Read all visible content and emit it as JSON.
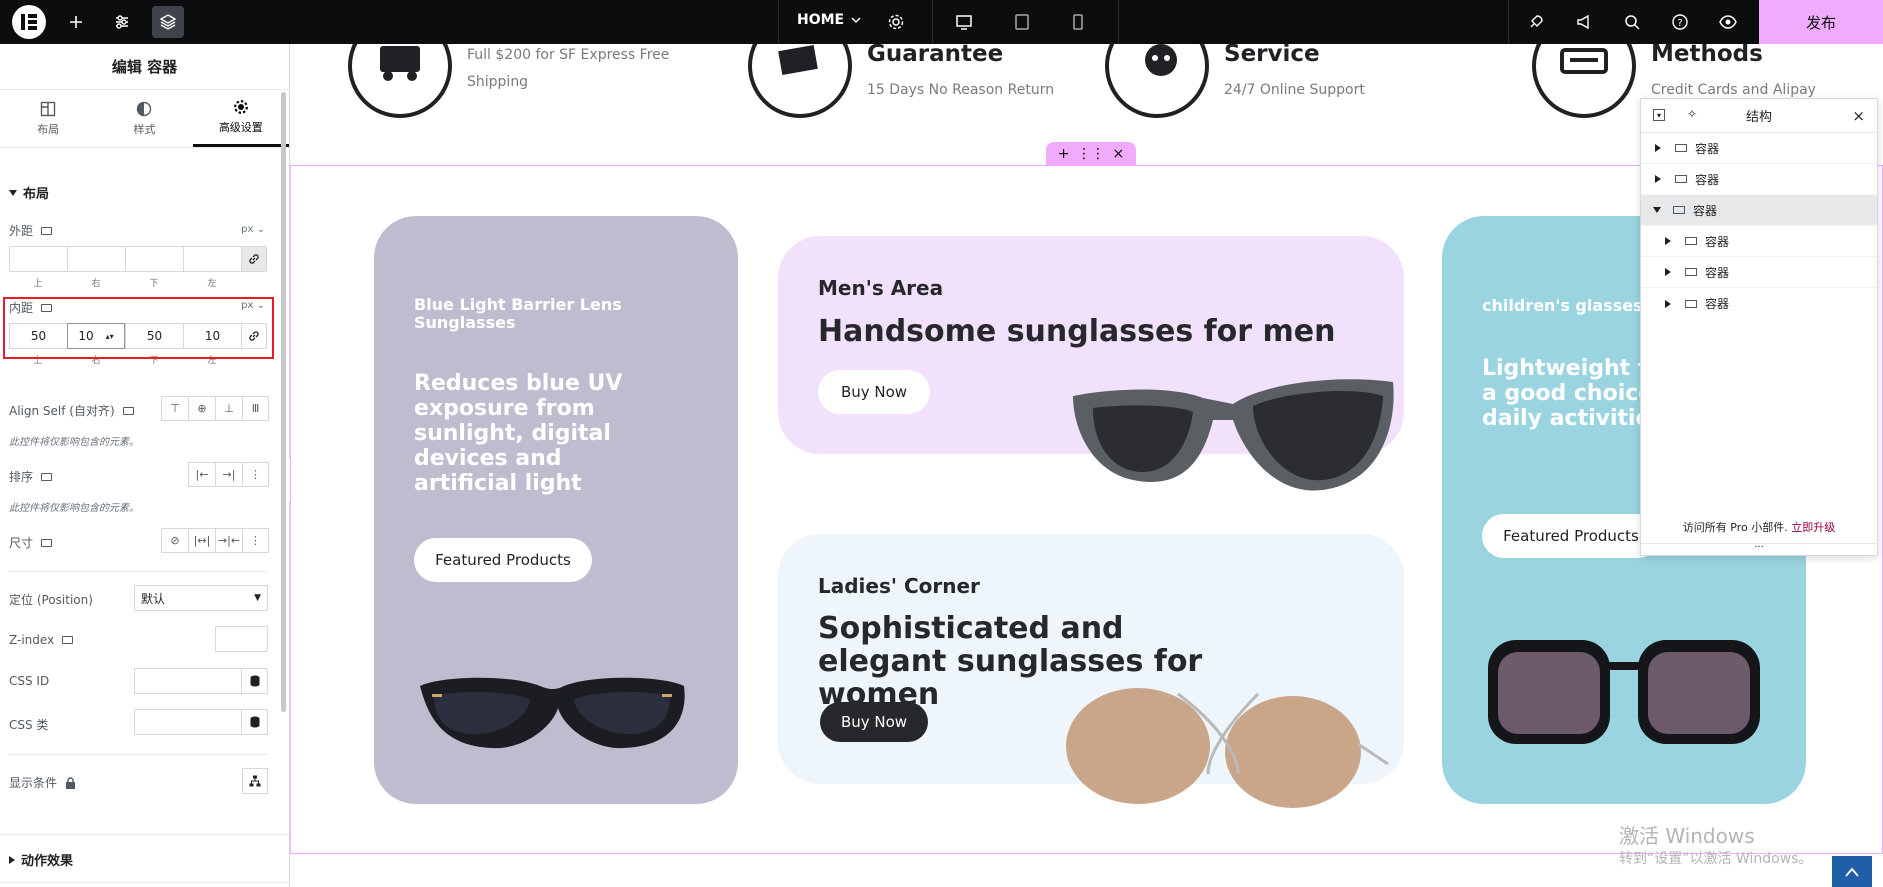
{
  "topbar": {
    "page_name": "HOME",
    "publish_label": "发布"
  },
  "left_panel": {
    "title": "编辑 容器",
    "tabs": [
      {
        "label": "布局",
        "icon": "layout-icon"
      },
      {
        "label": "样式",
        "icon": "style-icon"
      },
      {
        "label": "高级设置",
        "icon": "gear-icon"
      }
    ],
    "active_tab": "高级设置",
    "section_layout": "布局",
    "margin": {
      "label": "外距",
      "unit": "px",
      "values": [
        "",
        "",
        "",
        ""
      ],
      "sides": [
        "上",
        "右",
        "下",
        "左"
      ]
    },
    "padding": {
      "label": "内距",
      "unit": "px",
      "values": [
        "50",
        "10",
        "50",
        "10"
      ],
      "sides": [
        "上",
        "右",
        "下",
        "左"
      ]
    },
    "align_self_label": "Align Self (自对齐)",
    "align_self_note": "此控件将仅影响包含的元素。",
    "order_label": "排序",
    "order_note": "此控件将仅影响包含的元素。",
    "size_label": "尺寸",
    "position_label": "定位 (Position)",
    "position_value": "默认",
    "zindex_label": "Z-index",
    "cssid_label": "CSS ID",
    "cssclass_label": "CSS 类",
    "display_cond_label": "显示条件",
    "motion_label": "动作效果"
  },
  "features": [
    {
      "title": "",
      "sub1": "Full $200 for SF Express Free",
      "sub2": "Shipping"
    },
    {
      "title": "Guarantee",
      "sub1": "15 Days No Reason Return"
    },
    {
      "title": "Service",
      "sub1": "24/7 Online Support"
    },
    {
      "title": "Methods",
      "sub1": "Credit Cards and Alipay"
    }
  ],
  "cards": {
    "blue_light": {
      "title": "Blue Light Barrier Lens Sunglasses",
      "text": "Reduces blue UV exposure from sunlight, digital devices and artificial light",
      "button": "Featured Products",
      "bg": "#c0bccf"
    },
    "men": {
      "kicker": "Men's Area",
      "title": "Handsome sunglasses for men",
      "button": "Buy Now",
      "bg": "#f2e1fb"
    },
    "ladies": {
      "kicker": "Ladies' Corner",
      "title": "Sophisticated and elegant sunglasses for women",
      "button": "Buy Now",
      "bg": "#eef5fb"
    },
    "children": {
      "title": "children's glasses",
      "text": "Lightweight te a good choice daily activities",
      "button": "Featured Products",
      "bg": "#9ad4e1"
    }
  },
  "structure_panel": {
    "title": "结构",
    "items": [
      {
        "label": "容器",
        "level": 0,
        "expanded": false
      },
      {
        "label": "容器",
        "level": 0,
        "expanded": false
      },
      {
        "label": "容器",
        "level": 0,
        "expanded": true,
        "selected": true
      },
      {
        "label": "容器",
        "level": 1,
        "expanded": false
      },
      {
        "label": "容器",
        "level": 1,
        "expanded": false
      },
      {
        "label": "容器",
        "level": 1,
        "expanded": false
      }
    ],
    "footer_text": "访问所有 Pro 小部件.",
    "footer_link": "立即升级"
  },
  "watermark": {
    "line1": "激活 Windows",
    "line2": "转到“设置”以激活 Windows。"
  },
  "colors": {
    "accent_pink": "#f0abfc",
    "topbar_bg": "#0c0d0e",
    "highlight_red": "#e31e24"
  }
}
